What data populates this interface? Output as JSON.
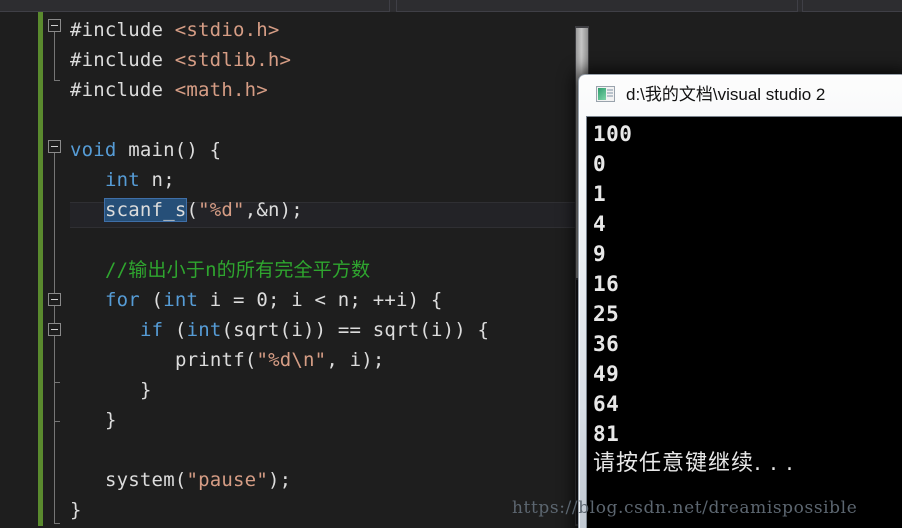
{
  "window": {
    "app": "visual-studio-editor",
    "background": "#1e1e1e"
  },
  "editor": {
    "change_bar_color": "#5a8a2e",
    "selection_color": "#264f78",
    "lines": [
      {
        "indent": 0,
        "tokens": [
          {
            "t": "#include ",
            "c": "plain"
          },
          {
            "t": "<stdio.h>",
            "c": "include"
          }
        ]
      },
      {
        "indent": 0,
        "tokens": [
          {
            "t": "#include ",
            "c": "plain"
          },
          {
            "t": "<stdlib.h>",
            "c": "include"
          }
        ]
      },
      {
        "indent": 0,
        "tokens": [
          {
            "t": "#include ",
            "c": "plain"
          },
          {
            "t": "<math.h>",
            "c": "include"
          }
        ]
      },
      {
        "indent": 0,
        "tokens": []
      },
      {
        "indent": 0,
        "tokens": [
          {
            "t": "void",
            "c": "keyword"
          },
          {
            "t": " main() {",
            "c": "plain"
          }
        ]
      },
      {
        "indent": 1,
        "tokens": [
          {
            "t": "int",
            "c": "keyword"
          },
          {
            "t": " n;",
            "c": "plain"
          }
        ]
      },
      {
        "indent": 1,
        "tokens": [
          {
            "t": "scanf_s",
            "c": "selected"
          },
          {
            "t": "(",
            "c": "plain"
          },
          {
            "t": "\"%d\"",
            "c": "string"
          },
          {
            "t": ",&n);",
            "c": "plain"
          }
        ]
      },
      {
        "indent": 0,
        "tokens": []
      },
      {
        "indent": 1,
        "tokens": [
          {
            "t": "//输出小于n的所有完全平方数",
            "c": "comment"
          }
        ]
      },
      {
        "indent": 1,
        "tokens": [
          {
            "t": "for",
            "c": "keyword"
          },
          {
            "t": " (",
            "c": "plain"
          },
          {
            "t": "int",
            "c": "keyword"
          },
          {
            "t": " i = 0; i < n; ++i) {",
            "c": "plain"
          }
        ]
      },
      {
        "indent": 2,
        "tokens": [
          {
            "t": "if",
            "c": "keyword"
          },
          {
            "t": " (",
            "c": "plain"
          },
          {
            "t": "int",
            "c": "keyword"
          },
          {
            "t": "(sqrt(i)) == sqrt(i)) {",
            "c": "plain"
          }
        ]
      },
      {
        "indent": 3,
        "tokens": [
          {
            "t": "printf(",
            "c": "plain"
          },
          {
            "t": "\"%d\\n\"",
            "c": "string"
          },
          {
            "t": ", i);",
            "c": "plain"
          }
        ]
      },
      {
        "indent": 2,
        "tokens": [
          {
            "t": "}",
            "c": "plain"
          }
        ]
      },
      {
        "indent": 1,
        "tokens": [
          {
            "t": "}",
            "c": "plain"
          }
        ]
      },
      {
        "indent": 0,
        "tokens": []
      },
      {
        "indent": 1,
        "tokens": [
          {
            "t": "system(",
            "c": "plain"
          },
          {
            "t": "\"pause\"",
            "c": "string"
          },
          {
            "t": ");",
            "c": "plain"
          }
        ]
      },
      {
        "indent": 0,
        "tokens": [
          {
            "t": "}",
            "c": "plain"
          }
        ]
      }
    ],
    "selected_text": "scanf_s",
    "fold_markers": [
      "collapse-include-block",
      "collapse-main",
      "collapse-for",
      "collapse-if"
    ]
  },
  "console": {
    "title": "d:\\我的文档\\visual studio 2",
    "icon": "console-window-icon",
    "output_lines": [
      "100",
      "0",
      "1",
      "4",
      "9",
      "16",
      "25",
      "36",
      "49",
      "64",
      "81"
    ],
    "prompt_line": "请按任意键继续. . ."
  },
  "watermark": {
    "text": "https://blog.csdn.net/dreamispossible"
  }
}
